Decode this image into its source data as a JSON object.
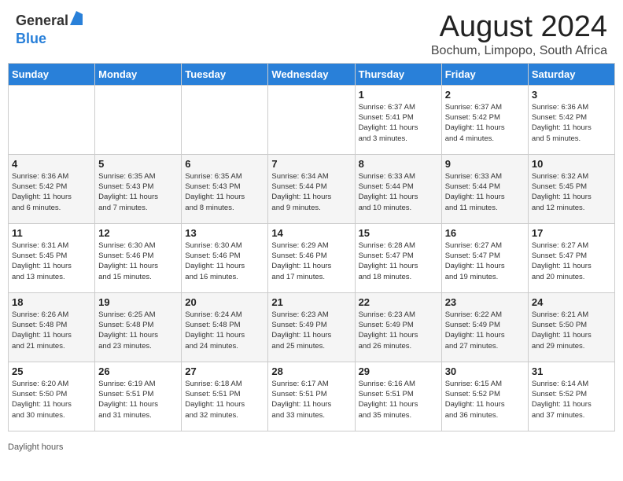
{
  "header": {
    "logo_general": "General",
    "logo_blue": "Blue",
    "title": "August 2024",
    "location": "Bochum, Limpopo, South Africa"
  },
  "days_of_week": [
    "Sunday",
    "Monday",
    "Tuesday",
    "Wednesday",
    "Thursday",
    "Friday",
    "Saturday"
  ],
  "weeks": [
    [
      {
        "day": "",
        "info": ""
      },
      {
        "day": "",
        "info": ""
      },
      {
        "day": "",
        "info": ""
      },
      {
        "day": "",
        "info": ""
      },
      {
        "day": "1",
        "info": "Sunrise: 6:37 AM\nSunset: 5:41 PM\nDaylight: 11 hours\nand 3 minutes."
      },
      {
        "day": "2",
        "info": "Sunrise: 6:37 AM\nSunset: 5:42 PM\nDaylight: 11 hours\nand 4 minutes."
      },
      {
        "day": "3",
        "info": "Sunrise: 6:36 AM\nSunset: 5:42 PM\nDaylight: 11 hours\nand 5 minutes."
      }
    ],
    [
      {
        "day": "4",
        "info": "Sunrise: 6:36 AM\nSunset: 5:42 PM\nDaylight: 11 hours\nand 6 minutes."
      },
      {
        "day": "5",
        "info": "Sunrise: 6:35 AM\nSunset: 5:43 PM\nDaylight: 11 hours\nand 7 minutes."
      },
      {
        "day": "6",
        "info": "Sunrise: 6:35 AM\nSunset: 5:43 PM\nDaylight: 11 hours\nand 8 minutes."
      },
      {
        "day": "7",
        "info": "Sunrise: 6:34 AM\nSunset: 5:44 PM\nDaylight: 11 hours\nand 9 minutes."
      },
      {
        "day": "8",
        "info": "Sunrise: 6:33 AM\nSunset: 5:44 PM\nDaylight: 11 hours\nand 10 minutes."
      },
      {
        "day": "9",
        "info": "Sunrise: 6:33 AM\nSunset: 5:44 PM\nDaylight: 11 hours\nand 11 minutes."
      },
      {
        "day": "10",
        "info": "Sunrise: 6:32 AM\nSunset: 5:45 PM\nDaylight: 11 hours\nand 12 minutes."
      }
    ],
    [
      {
        "day": "11",
        "info": "Sunrise: 6:31 AM\nSunset: 5:45 PM\nDaylight: 11 hours\nand 13 minutes."
      },
      {
        "day": "12",
        "info": "Sunrise: 6:30 AM\nSunset: 5:46 PM\nDaylight: 11 hours\nand 15 minutes."
      },
      {
        "day": "13",
        "info": "Sunrise: 6:30 AM\nSunset: 5:46 PM\nDaylight: 11 hours\nand 16 minutes."
      },
      {
        "day": "14",
        "info": "Sunrise: 6:29 AM\nSunset: 5:46 PM\nDaylight: 11 hours\nand 17 minutes."
      },
      {
        "day": "15",
        "info": "Sunrise: 6:28 AM\nSunset: 5:47 PM\nDaylight: 11 hours\nand 18 minutes."
      },
      {
        "day": "16",
        "info": "Sunrise: 6:27 AM\nSunset: 5:47 PM\nDaylight: 11 hours\nand 19 minutes."
      },
      {
        "day": "17",
        "info": "Sunrise: 6:27 AM\nSunset: 5:47 PM\nDaylight: 11 hours\nand 20 minutes."
      }
    ],
    [
      {
        "day": "18",
        "info": "Sunrise: 6:26 AM\nSunset: 5:48 PM\nDaylight: 11 hours\nand 21 minutes."
      },
      {
        "day": "19",
        "info": "Sunrise: 6:25 AM\nSunset: 5:48 PM\nDaylight: 11 hours\nand 23 minutes."
      },
      {
        "day": "20",
        "info": "Sunrise: 6:24 AM\nSunset: 5:48 PM\nDaylight: 11 hours\nand 24 minutes."
      },
      {
        "day": "21",
        "info": "Sunrise: 6:23 AM\nSunset: 5:49 PM\nDaylight: 11 hours\nand 25 minutes."
      },
      {
        "day": "22",
        "info": "Sunrise: 6:23 AM\nSunset: 5:49 PM\nDaylight: 11 hours\nand 26 minutes."
      },
      {
        "day": "23",
        "info": "Sunrise: 6:22 AM\nSunset: 5:49 PM\nDaylight: 11 hours\nand 27 minutes."
      },
      {
        "day": "24",
        "info": "Sunrise: 6:21 AM\nSunset: 5:50 PM\nDaylight: 11 hours\nand 29 minutes."
      }
    ],
    [
      {
        "day": "25",
        "info": "Sunrise: 6:20 AM\nSunset: 5:50 PM\nDaylight: 11 hours\nand 30 minutes."
      },
      {
        "day": "26",
        "info": "Sunrise: 6:19 AM\nSunset: 5:51 PM\nDaylight: 11 hours\nand 31 minutes."
      },
      {
        "day": "27",
        "info": "Sunrise: 6:18 AM\nSunset: 5:51 PM\nDaylight: 11 hours\nand 32 minutes."
      },
      {
        "day": "28",
        "info": "Sunrise: 6:17 AM\nSunset: 5:51 PM\nDaylight: 11 hours\nand 33 minutes."
      },
      {
        "day": "29",
        "info": "Sunrise: 6:16 AM\nSunset: 5:51 PM\nDaylight: 11 hours\nand 35 minutes."
      },
      {
        "day": "30",
        "info": "Sunrise: 6:15 AM\nSunset: 5:52 PM\nDaylight: 11 hours\nand 36 minutes."
      },
      {
        "day": "31",
        "info": "Sunrise: 6:14 AM\nSunset: 5:52 PM\nDaylight: 11 hours\nand 37 minutes."
      }
    ]
  ],
  "footer": {
    "daylight_label": "Daylight hours"
  }
}
